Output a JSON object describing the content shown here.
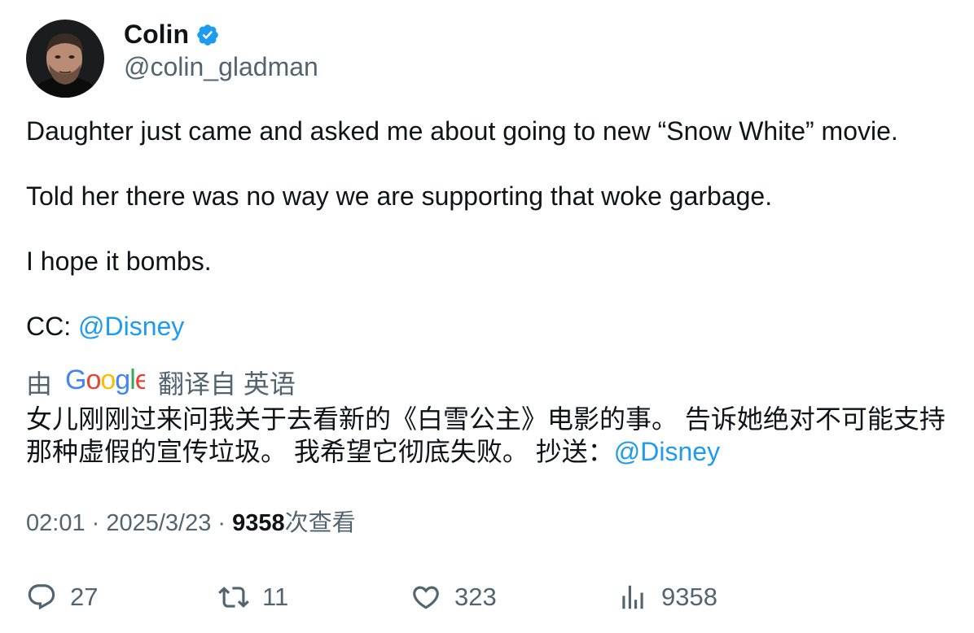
{
  "author": {
    "display_name": "Colin",
    "handle": "@colin_gladman",
    "verified": true
  },
  "tweet": {
    "lines": [
      "Daughter just came and asked me about going to new “Snow White” movie.",
      "Told her there was no way we are supporting that woke garbage.",
      "I hope it bombs."
    ],
    "cc_prefix": "CC: ",
    "mention": "@Disney"
  },
  "translation": {
    "by_label": "由",
    "provider": "Google",
    "from_label": "翻译自 英语",
    "text_line1": "女儿刚刚过来问我关于去看新的《白雪公主》电影的事。 告诉她绝对不可能支持",
    "text_line2": "那种虚假的宣传垃圾。 我希望它彻底失败。 抄送：",
    "mention": "@Disney"
  },
  "meta": {
    "time": "02:01",
    "separator": " · ",
    "date": "2025/3/23",
    "views_count": "9358",
    "views_label": "次查看"
  },
  "actions": {
    "replies": "27",
    "retweets": "11",
    "likes": "323",
    "views": "9358"
  },
  "colors": {
    "text": "#0f1419",
    "secondary": "#536471",
    "accent": "#1d9bf0"
  }
}
